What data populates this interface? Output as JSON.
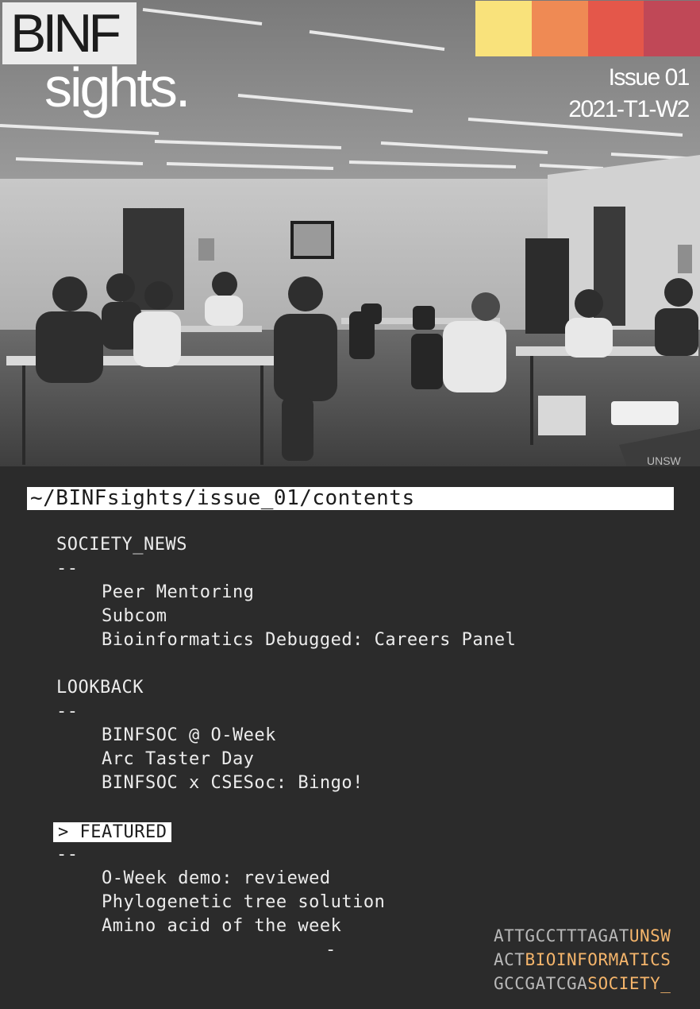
{
  "masthead": {
    "logo_top": "BINF",
    "logo_bottom": "sights.",
    "issue": "Issue 01",
    "term": "2021-T1-W2"
  },
  "swatch_colors": [
    "#f9e27b",
    "#ef8a54",
    "#e4574a",
    "#c04857"
  ],
  "contents": {
    "path": "~/BINFsights/issue_01/contents",
    "separator": "--",
    "sections": [
      {
        "heading": "SOCIETY_NEWS",
        "items": [
          "Peer Mentoring",
          "Subcom",
          "Bioinformatics Debugged: Careers Panel"
        ]
      },
      {
        "heading": "LOOKBACK",
        "items": [
          "BINFSOC @ O-Week",
          "Arc Taster Day",
          "BINFSOC x CSESoc: Bingo!"
        ]
      },
      {
        "heading": "> FEATURED",
        "items": [
          "O-Week demo: reviewed",
          "Phylogenetic tree solution",
          "Amino acid of the week"
        ]
      }
    ],
    "trailing_dash": "-"
  },
  "dna_signature": [
    {
      "seq": "ATTGCCTTTAGAT",
      "word": "UNSW"
    },
    {
      "seq": "ACT",
      "word": "BIOINFORMATICS"
    },
    {
      "seq": "GCCGATCGA",
      "word": "SOCIETY_"
    }
  ],
  "photo_sign": "UNSW"
}
